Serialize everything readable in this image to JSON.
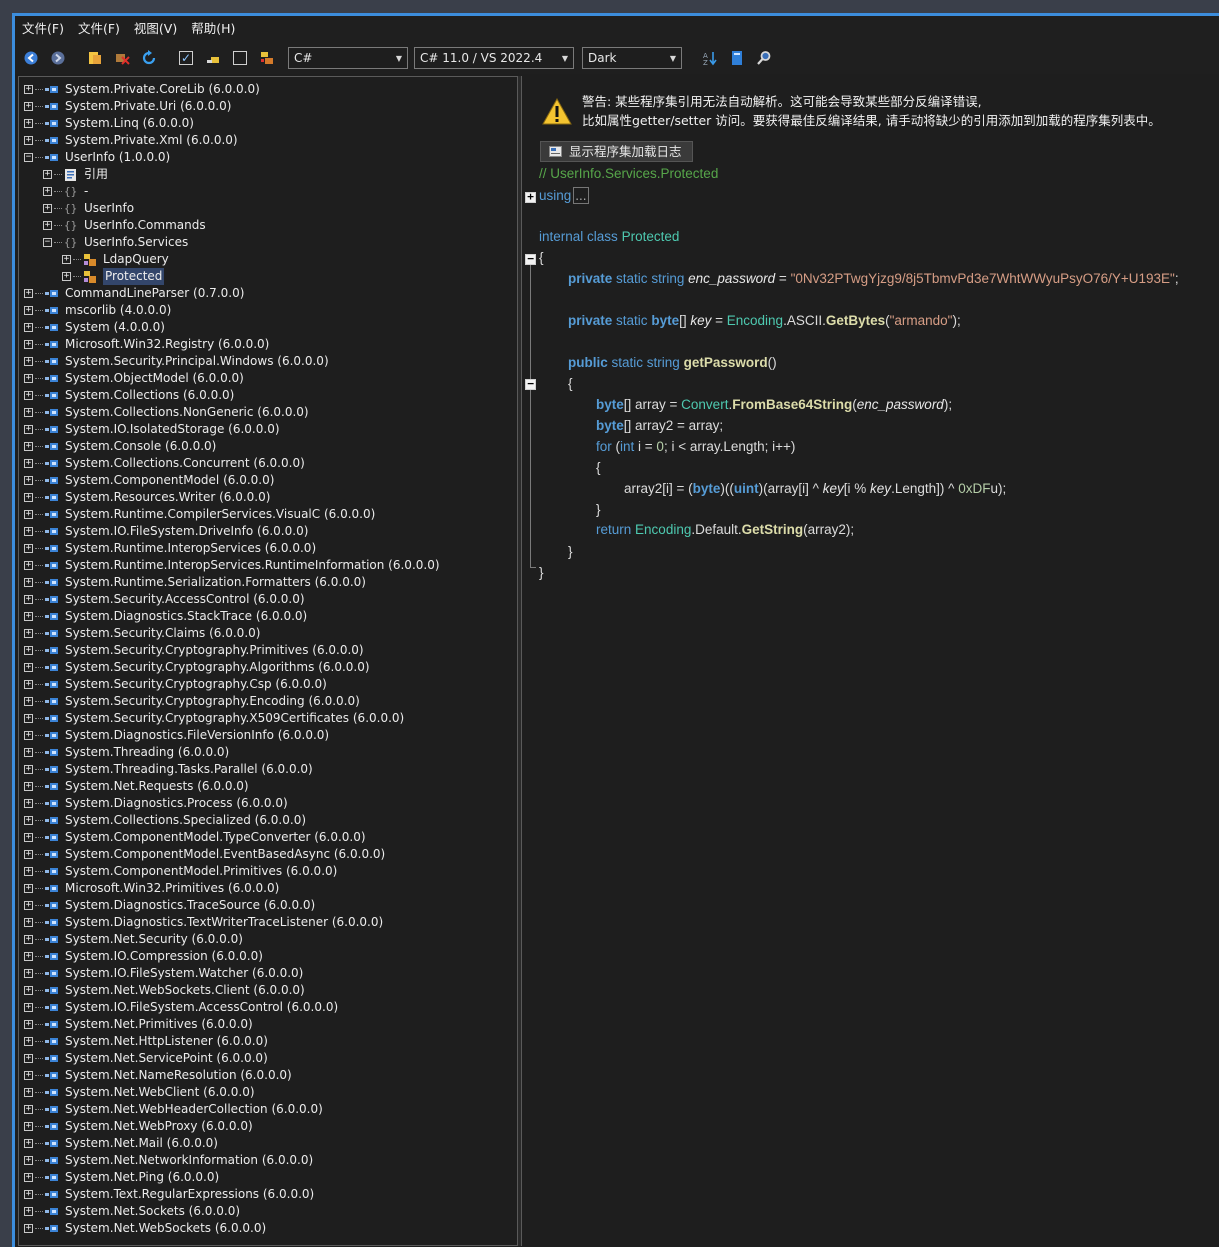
{
  "menu": [
    "文件(F)",
    "文件(F)",
    "视图(V)",
    "帮助(H)"
  ],
  "toolbar": {
    "language": "C#",
    "version": "C# 11.0 / VS 2022.4",
    "theme": "Dark"
  },
  "tree": [
    {
      "label": "System.Private.CoreLib (6.0.0.0)",
      "level": 0,
      "icon": "assembly",
      "exp": "+"
    },
    {
      "label": "System.Private.Uri (6.0.0.0)",
      "level": 0,
      "icon": "assembly",
      "exp": "+"
    },
    {
      "label": "System.Linq (6.0.0.0)",
      "level": 0,
      "icon": "assembly",
      "exp": "+"
    },
    {
      "label": "System.Private.Xml (6.0.0.0)",
      "level": 0,
      "icon": "assembly",
      "exp": "+"
    },
    {
      "label": "UserInfo (1.0.0.0)",
      "level": 0,
      "icon": "assembly",
      "exp": "-"
    },
    {
      "label": "引用",
      "level": 1,
      "icon": "references",
      "exp": "+"
    },
    {
      "label": "-",
      "level": 1,
      "icon": "namespace",
      "exp": "+"
    },
    {
      "label": "UserInfo",
      "level": 1,
      "icon": "namespace",
      "exp": "+"
    },
    {
      "label": "UserInfo.Commands",
      "level": 1,
      "icon": "namespace",
      "exp": "+"
    },
    {
      "label": "UserInfo.Services",
      "level": 1,
      "icon": "namespace",
      "exp": "-"
    },
    {
      "label": "LdapQuery",
      "level": 2,
      "icon": "class",
      "exp": "+"
    },
    {
      "label": "Protected",
      "level": 2,
      "icon": "class",
      "exp": "+",
      "selected": true
    },
    {
      "label": "CommandLineParser (0.7.0.0)",
      "level": 0,
      "icon": "assembly",
      "exp": "+"
    },
    {
      "label": "mscorlib (4.0.0.0)",
      "level": 0,
      "icon": "assembly",
      "exp": "+"
    },
    {
      "label": "System (4.0.0.0)",
      "level": 0,
      "icon": "assembly",
      "exp": "+"
    },
    {
      "label": "Microsoft.Win32.Registry (6.0.0.0)",
      "level": 0,
      "icon": "assembly",
      "exp": "+"
    },
    {
      "label": "System.Security.Principal.Windows (6.0.0.0)",
      "level": 0,
      "icon": "assembly",
      "exp": "+"
    },
    {
      "label": "System.ObjectModel (6.0.0.0)",
      "level": 0,
      "icon": "assembly",
      "exp": "+"
    },
    {
      "label": "System.Collections (6.0.0.0)",
      "level": 0,
      "icon": "assembly",
      "exp": "+"
    },
    {
      "label": "System.Collections.NonGeneric (6.0.0.0)",
      "level": 0,
      "icon": "assembly",
      "exp": "+"
    },
    {
      "label": "System.IO.IsolatedStorage (6.0.0.0)",
      "level": 0,
      "icon": "assembly",
      "exp": "+"
    },
    {
      "label": "System.Console (6.0.0.0)",
      "level": 0,
      "icon": "assembly",
      "exp": "+"
    },
    {
      "label": "System.Collections.Concurrent (6.0.0.0)",
      "level": 0,
      "icon": "assembly",
      "exp": "+"
    },
    {
      "label": "System.ComponentModel (6.0.0.0)",
      "level": 0,
      "icon": "assembly",
      "exp": "+"
    },
    {
      "label": "System.Resources.Writer (6.0.0.0)",
      "level": 0,
      "icon": "assembly",
      "exp": "+"
    },
    {
      "label": "System.Runtime.CompilerServices.VisualC (6.0.0.0)",
      "level": 0,
      "icon": "assembly",
      "exp": "+"
    },
    {
      "label": "System.IO.FileSystem.DriveInfo (6.0.0.0)",
      "level": 0,
      "icon": "assembly",
      "exp": "+"
    },
    {
      "label": "System.Runtime.InteropServices (6.0.0.0)",
      "level": 0,
      "icon": "assembly",
      "exp": "+"
    },
    {
      "label": "System.Runtime.InteropServices.RuntimeInformation (6.0.0.0)",
      "level": 0,
      "icon": "assembly",
      "exp": "+"
    },
    {
      "label": "System.Runtime.Serialization.Formatters (6.0.0.0)",
      "level": 0,
      "icon": "assembly",
      "exp": "+"
    },
    {
      "label": "System.Security.AccessControl (6.0.0.0)",
      "level": 0,
      "icon": "assembly",
      "exp": "+"
    },
    {
      "label": "System.Diagnostics.StackTrace (6.0.0.0)",
      "level": 0,
      "icon": "assembly",
      "exp": "+"
    },
    {
      "label": "System.Security.Claims (6.0.0.0)",
      "level": 0,
      "icon": "assembly",
      "exp": "+"
    },
    {
      "label": "System.Security.Cryptography.Primitives (6.0.0.0)",
      "level": 0,
      "icon": "assembly",
      "exp": "+"
    },
    {
      "label": "System.Security.Cryptography.Algorithms (6.0.0.0)",
      "level": 0,
      "icon": "assembly",
      "exp": "+"
    },
    {
      "label": "System.Security.Cryptography.Csp (6.0.0.0)",
      "level": 0,
      "icon": "assembly",
      "exp": "+"
    },
    {
      "label": "System.Security.Cryptography.Encoding (6.0.0.0)",
      "level": 0,
      "icon": "assembly",
      "exp": "+"
    },
    {
      "label": "System.Security.Cryptography.X509Certificates (6.0.0.0)",
      "level": 0,
      "icon": "assembly",
      "exp": "+"
    },
    {
      "label": "System.Diagnostics.FileVersionInfo (6.0.0.0)",
      "level": 0,
      "icon": "assembly",
      "exp": "+"
    },
    {
      "label": "System.Threading (6.0.0.0)",
      "level": 0,
      "icon": "assembly",
      "exp": "+"
    },
    {
      "label": "System.Threading.Tasks.Parallel (6.0.0.0)",
      "level": 0,
      "icon": "assembly",
      "exp": "+"
    },
    {
      "label": "System.Net.Requests (6.0.0.0)",
      "level": 0,
      "icon": "assembly",
      "exp": "+"
    },
    {
      "label": "System.Diagnostics.Process (6.0.0.0)",
      "level": 0,
      "icon": "assembly",
      "exp": "+"
    },
    {
      "label": "System.Collections.Specialized (6.0.0.0)",
      "level": 0,
      "icon": "assembly",
      "exp": "+"
    },
    {
      "label": "System.ComponentModel.TypeConverter (6.0.0.0)",
      "level": 0,
      "icon": "assembly",
      "exp": "+"
    },
    {
      "label": "System.ComponentModel.EventBasedAsync (6.0.0.0)",
      "level": 0,
      "icon": "assembly",
      "exp": "+"
    },
    {
      "label": "System.ComponentModel.Primitives (6.0.0.0)",
      "level": 0,
      "icon": "assembly",
      "exp": "+"
    },
    {
      "label": "Microsoft.Win32.Primitives (6.0.0.0)",
      "level": 0,
      "icon": "assembly",
      "exp": "+"
    },
    {
      "label": "System.Diagnostics.TraceSource (6.0.0.0)",
      "level": 0,
      "icon": "assembly",
      "exp": "+"
    },
    {
      "label": "System.Diagnostics.TextWriterTraceListener (6.0.0.0)",
      "level": 0,
      "icon": "assembly",
      "exp": "+"
    },
    {
      "label": "System.Net.Security (6.0.0.0)",
      "level": 0,
      "icon": "assembly",
      "exp": "+"
    },
    {
      "label": "System.IO.Compression (6.0.0.0)",
      "level": 0,
      "icon": "assembly",
      "exp": "+"
    },
    {
      "label": "System.IO.FileSystem.Watcher (6.0.0.0)",
      "level": 0,
      "icon": "assembly",
      "exp": "+"
    },
    {
      "label": "System.Net.WebSockets.Client (6.0.0.0)",
      "level": 0,
      "icon": "assembly",
      "exp": "+"
    },
    {
      "label": "System.IO.FileSystem.AccessControl (6.0.0.0)",
      "level": 0,
      "icon": "assembly",
      "exp": "+"
    },
    {
      "label": "System.Net.Primitives (6.0.0.0)",
      "level": 0,
      "icon": "assembly",
      "exp": "+"
    },
    {
      "label": "System.Net.HttpListener (6.0.0.0)",
      "level": 0,
      "icon": "assembly",
      "exp": "+"
    },
    {
      "label": "System.Net.ServicePoint (6.0.0.0)",
      "level": 0,
      "icon": "assembly",
      "exp": "+"
    },
    {
      "label": "System.Net.NameResolution (6.0.0.0)",
      "level": 0,
      "icon": "assembly",
      "exp": "+"
    },
    {
      "label": "System.Net.WebClient (6.0.0.0)",
      "level": 0,
      "icon": "assembly",
      "exp": "+"
    },
    {
      "label": "System.Net.WebHeaderCollection (6.0.0.0)",
      "level": 0,
      "icon": "assembly",
      "exp": "+"
    },
    {
      "label": "System.Net.WebProxy (6.0.0.0)",
      "level": 0,
      "icon": "assembly",
      "exp": "+"
    },
    {
      "label": "System.Net.Mail (6.0.0.0)",
      "level": 0,
      "icon": "assembly",
      "exp": "+"
    },
    {
      "label": "System.Net.NetworkInformation (6.0.0.0)",
      "level": 0,
      "icon": "assembly",
      "exp": "+"
    },
    {
      "label": "System.Net.Ping (6.0.0.0)",
      "level": 0,
      "icon": "assembly",
      "exp": "+"
    },
    {
      "label": "System.Text.RegularExpressions (6.0.0.0)",
      "level": 0,
      "icon": "assembly",
      "exp": "+"
    },
    {
      "label": "System.Net.Sockets (6.0.0.0)",
      "level": 0,
      "icon": "assembly",
      "exp": "+"
    },
    {
      "label": "System.Net.WebSockets (6.0.0.0)",
      "level": 0,
      "icon": "assembly",
      "exp": "+"
    }
  ],
  "warning": {
    "line1": "警告: 某些程序集引用无法自动解析。这可能会导致某些部分反编译错误,",
    "line2": "比如属性getter/setter 访问。要获得最佳反编译结果, 请手动将缺少的引用添加到加载的程序集列表中。",
    "button": "显示程序集加载日志"
  },
  "code": {
    "comment": "// UserInfo.Services.Protected",
    "using_kw": "using",
    "using_ellipsis": "...",
    "class_mod": "internal",
    "class_kw": "class",
    "class_name": "Protected",
    "open_brace": "{",
    "close_brace": "}",
    "f1_mod": "private",
    "f1_static": "static",
    "f1_type": "string",
    "f1_name": "enc_password",
    "f1_eq": " = ",
    "f1_value": "\"0Nv32PTwgYjzg9/8j5TbmvPd3e7WhtWWyuPsyO76/Y+U193E\"",
    "f1_end": ";",
    "f2_mod": "private",
    "f2_static": "static",
    "f2_type": "byte",
    "f2_arr": "[] ",
    "f2_name": "key",
    "f2_eq": " = ",
    "f2_enc": "Encoding",
    "f2_ascii": ".ASCII.",
    "f2_fn": "GetBytes",
    "f2_open": "(",
    "f2_str": "\"armando\"",
    "f2_close": ");",
    "m_mod": "public",
    "m_static": "static",
    "m_type": "string",
    "m_name": "getPassword",
    "m_parens": "()",
    "l1_type": "byte",
    "l1_rest": "[] array = ",
    "l1_cls": "Convert",
    "l1_dot": ".",
    "l1_fn": "FromBase64String",
    "l1_open": "(",
    "l1_arg": "enc_password",
    "l1_close": ");",
    "l2_type": "byte",
    "l2_rest": "[] array2 = array;",
    "for_kw": "for",
    "for_open": " (",
    "for_int": "int",
    "for_i": " i = ",
    "for_zero": "0",
    "for_rest": "; i < array.Length; i++)",
    "body_a": "array2[i] = (",
    "body_byte": "byte",
    "body_b": ")((",
    "body_uint": "uint",
    "body_c": ")(array[i] ^ ",
    "body_key1": "key",
    "body_d": "[i % ",
    "body_key2": "key",
    "body_e": ".Length]) ^ ",
    "body_hex": "0xDF",
    "body_f": "u);",
    "ret_kw": "return",
    "ret_enc": "Encoding",
    "ret_default": ".Default.",
    "ret_fn": "GetString",
    "ret_rest": "(array2);"
  }
}
